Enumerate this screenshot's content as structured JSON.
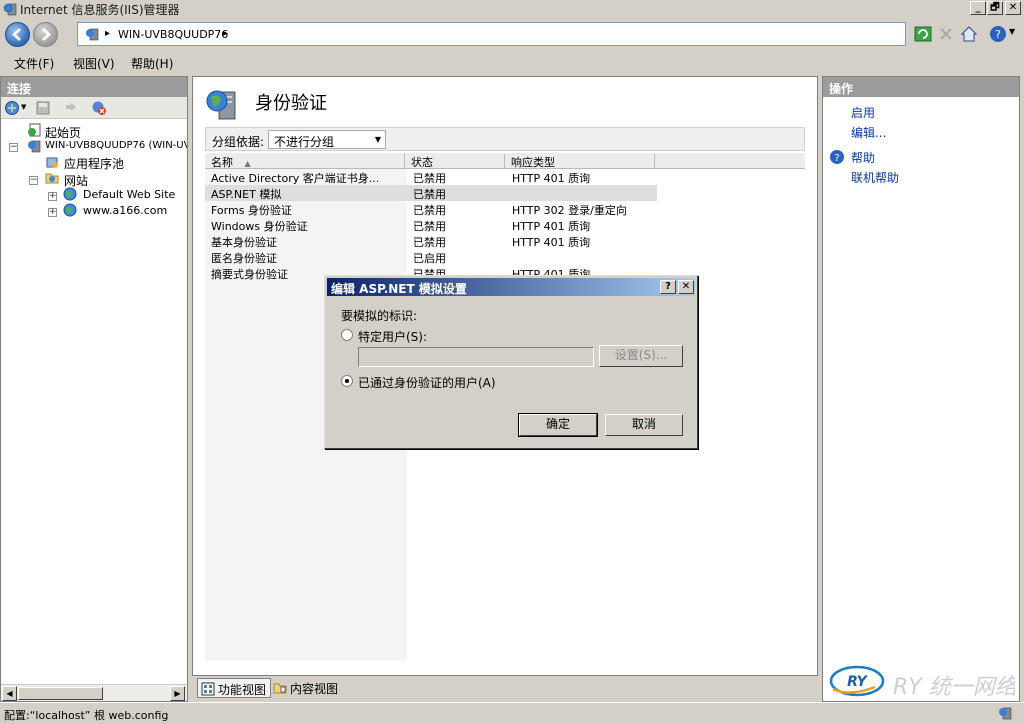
{
  "window": {
    "title": "Internet 信息服务(IIS)管理器",
    "buttons": [
      "_",
      "🗗",
      "✕"
    ]
  },
  "address": {
    "arrow1": "▸",
    "path": "WIN-UVB8QUUDP76",
    "arrow2": "▸"
  },
  "menu": [
    {
      "label": "文件(F)"
    },
    {
      "label": "视图(V)"
    },
    {
      "label": "帮助(H)"
    }
  ],
  "connections": {
    "header": "连接",
    "tree": [
      {
        "label": "起始页"
      },
      {
        "label": "WIN-UVB8QUUDP76 (WIN-UVI"
      },
      {
        "label": "应用程序池"
      },
      {
        "label": "网站"
      },
      {
        "label": "Default Web Site"
      },
      {
        "label": "www.a166.com"
      }
    ]
  },
  "main": {
    "title": "身份验证",
    "group_label": "分组依据:",
    "group_value": "不进行分组",
    "columns": [
      "名称",
      "状态",
      "响应类型"
    ],
    "rows": [
      {
        "name": "Active Directory 客户端证书身...",
        "status": "已禁用",
        "response": "HTTP 401 质询"
      },
      {
        "name": "ASP.NET 模拟",
        "status": "已禁用",
        "response": ""
      },
      {
        "name": "Forms 身份验证",
        "status": "已禁用",
        "response": "HTTP 302 登录/重定向"
      },
      {
        "name": "Windows 身份验证",
        "status": "已禁用",
        "response": "HTTP 401 质询"
      },
      {
        "name": "基本身份验证",
        "status": "已禁用",
        "response": "HTTP 401 质询"
      },
      {
        "name": "匿名身份验证",
        "status": "已启用",
        "response": ""
      },
      {
        "name": "摘要式身份验证",
        "status": "已禁用",
        "response": "HTTP 401 质询"
      }
    ],
    "tabs": [
      {
        "label": "功能视图"
      },
      {
        "label": "内容视图"
      }
    ]
  },
  "actions": {
    "header": "操作",
    "items": [
      {
        "label": "启用"
      },
      {
        "label": "编辑..."
      },
      {
        "label": "帮助"
      },
      {
        "label": "联机帮助"
      }
    ],
    "brand": "RY 统一网络"
  },
  "status": {
    "text": "配置:“localhost” 根 web.config"
  },
  "dialog": {
    "title": "编辑 ASP.NET 模拟设置",
    "help_button": "?",
    "close_button": "✕",
    "identity_label": "要模拟的标识:",
    "specific_user_label": "特定用户(S):",
    "set_button": "设置(S)...",
    "authenticated_user_label": "已通过身份验证的用户(A)",
    "ok_button": "确定",
    "cancel_button": "取消",
    "specific_user_selected": false,
    "authenticated_user_selected": true
  }
}
